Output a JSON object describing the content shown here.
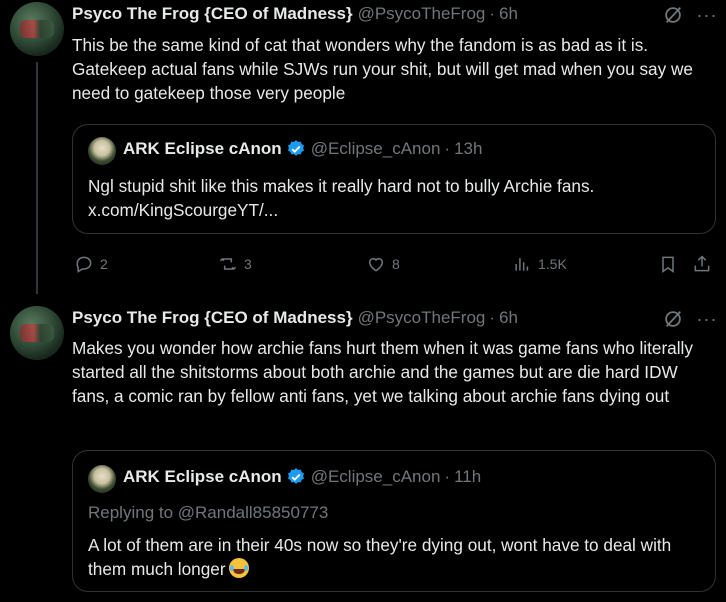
{
  "tweets": [
    {
      "name": "Psyco The Frog {CEO of Madness}",
      "handle": "@PsycoTheFrog",
      "time": "6h",
      "text": "This be the same kind of cat that wonders why the fandom is as bad as it is. Gatekeep actual fans while SJWs run your shit, but will get mad when you say we need to gatekeep those very people",
      "quote": {
        "name": "ARK Eclipse cAnon",
        "handle": "@Eclipse_cAnon",
        "time": "13h",
        "text": "Ngl stupid shit like this makes it really hard not to bully Archie fans. x.com/KingScourgeYT/..."
      },
      "actions": {
        "replies": "2",
        "reposts": "3",
        "likes": "8",
        "views": "1.5K"
      }
    },
    {
      "name": "Psyco The Frog {CEO of Madness}",
      "handle": "@PsycoTheFrog",
      "time": "6h",
      "text": "Makes you wonder how archie fans hurt them when it was game fans who literally started all the shitstorms about both archie and the games but are die hard IDW fans, a comic ran by fellow anti fans, yet we talking about archie fans dying out",
      "quote": {
        "name": "ARK Eclipse cAnon",
        "handle": "@Eclipse_cAnon",
        "time": "11h",
        "replying": "Replying to @Randall85850773",
        "text": "A lot of them are in their 40s now so they're dying out, wont have to deal with them much longer"
      }
    }
  ],
  "dot": "·",
  "more_icon": "···",
  "colors": {
    "background": "#000000",
    "text": "#e7e9ea",
    "muted": "#71767b",
    "verified": "#1d9bf0",
    "border": "#2f3336"
  },
  "icons": [
    "reply-icon",
    "repost-icon",
    "like-icon",
    "views-icon",
    "bookmark-icon",
    "share-icon",
    "grok-icon",
    "more-icon",
    "verified-icon",
    "laughing-emoji"
  ]
}
